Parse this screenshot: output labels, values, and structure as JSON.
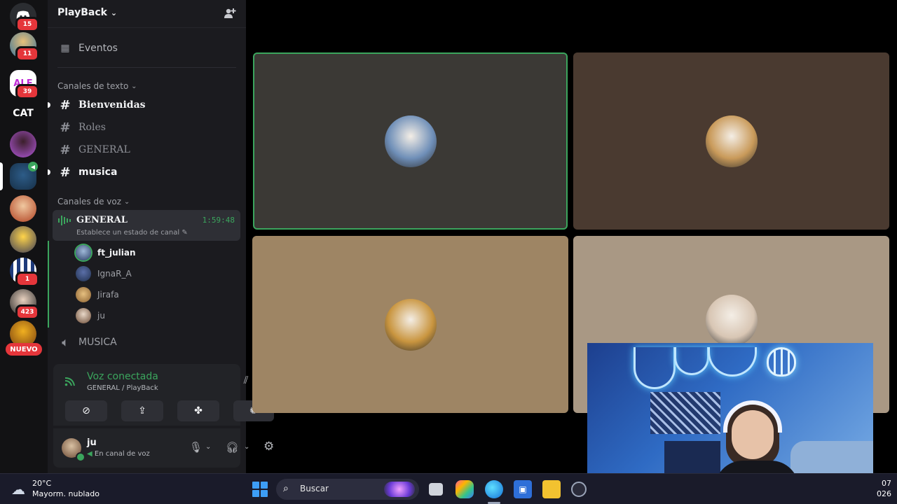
{
  "rail": {
    "badges": [
      "15",
      "11",
      "39",
      "1",
      "423"
    ],
    "cat_label": "CAT",
    "nuevo_label": "NUEVO"
  },
  "server": {
    "name": "PlayBack",
    "chevron": "chevron-down-icon",
    "events_label": "Eventos"
  },
  "text_category": {
    "label": "Canales de texto",
    "channels": [
      {
        "name": "Bienvenidas",
        "unread": true
      },
      {
        "name": "Roles",
        "unread": false
      },
      {
        "name": "GENERAL",
        "unread": false
      },
      {
        "name": "musica",
        "unread": true
      }
    ]
  },
  "voice_category": {
    "label": "Canales de voz",
    "active_channel": {
      "name": "GENERAL",
      "status": "Establece un estado de canal",
      "elapsed": "1:59:48"
    },
    "members": [
      "ft_julian",
      "IgnaR_A",
      "Jirafa",
      "ju"
    ],
    "other_channels": [
      "MUSICA"
    ]
  },
  "voice_panel": {
    "title": "Voz conectada",
    "location": "GENERAL / PlayBack"
  },
  "user": {
    "name": "ju",
    "status": "En canal de voz"
  },
  "tiles": [
    {
      "bg": "#3b3935",
      "speaking": true,
      "avatar_color": "#6f8fb8"
    },
    {
      "bg": "#4a3a30",
      "speaking": false,
      "avatar_color": "#c99a5a"
    },
    {
      "bg": "#9e8564",
      "speaking": false,
      "avatar_color": "#c9953f"
    },
    {
      "bg": "#a99884",
      "speaking": false,
      "avatar_color": "#d8c6b4"
    }
  ],
  "colors": {
    "accent_green": "#3ba55d",
    "badge_red": "#e5363b",
    "sidebar_bg": "#1b1b1f",
    "rail_bg": "#121214"
  },
  "taskbar": {
    "temperature": "20°C",
    "condition": "Mayorm. nublado",
    "search_placeholder": "Buscar",
    "clock_time": "07",
    "clock_date": "026"
  }
}
